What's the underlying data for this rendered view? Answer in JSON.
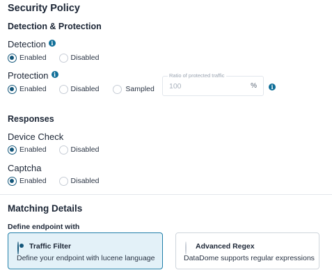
{
  "page_title": "Security Policy",
  "detection_protection": {
    "heading": "Detection & Protection",
    "detection": {
      "label": "Detection",
      "options": [
        {
          "label": "Enabled",
          "checked": true
        },
        {
          "label": "Disabled",
          "checked": false
        }
      ]
    },
    "protection": {
      "label": "Protection",
      "options": [
        {
          "label": "Enabled",
          "checked": true
        },
        {
          "label": "Disabled",
          "checked": false
        },
        {
          "label": "Sampled",
          "checked": false
        }
      ],
      "ratio_field": {
        "legend": "Ratio of protected traffic",
        "placeholder": "100",
        "unit": "%"
      }
    }
  },
  "responses": {
    "heading": "Responses",
    "device_check": {
      "label": "Device Check",
      "options": [
        {
          "label": "Enabled",
          "checked": true
        },
        {
          "label": "Disabled",
          "checked": false
        }
      ]
    },
    "captcha": {
      "label": "Captcha",
      "options": [
        {
          "label": "Enabled",
          "checked": true
        },
        {
          "label": "Disabled",
          "checked": false
        }
      ]
    }
  },
  "matching": {
    "heading": "Matching Details",
    "define_label": "Define endpoint with",
    "cards": [
      {
        "title": "Traffic Filter",
        "description": "Define your endpoint with lucene language",
        "selected": true
      },
      {
        "title": "Advanced Regex",
        "description": "DataDome supports regular expressions",
        "selected": false
      }
    ]
  },
  "icons": {
    "info": "info-icon",
    "info_color": "#0f6e98",
    "accent": "#13567a",
    "selected_card_bg": "#e3f1f8"
  }
}
